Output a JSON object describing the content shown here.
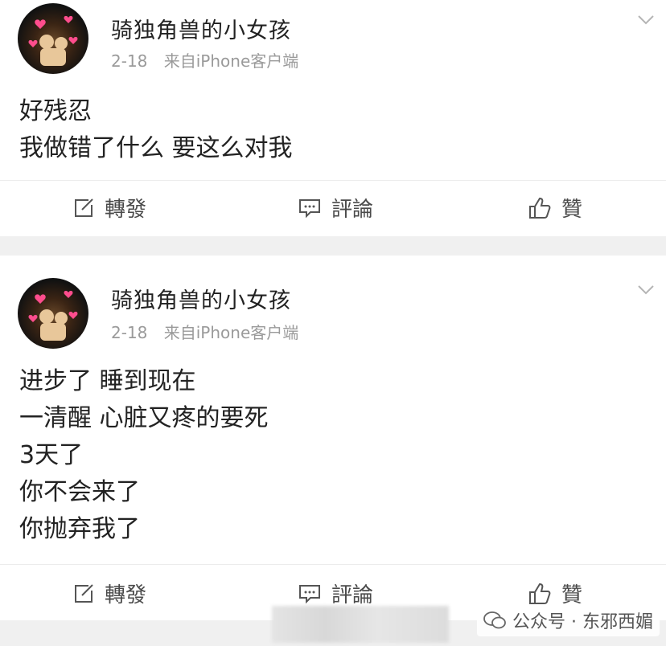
{
  "posts": [
    {
      "username": "骑独角兽的小女孩",
      "date": "2-18",
      "source": "来自iPhone客户端",
      "lines": [
        "好残忍",
        "我做错了什么 要这么对我"
      ],
      "actions": {
        "repost": "轉發",
        "comment": "評論",
        "like": "贊"
      }
    },
    {
      "username": "骑独角兽的小女孩",
      "date": "2-18",
      "source": "来自iPhone客户端",
      "lines": [
        "进步了 睡到现在",
        "一清醒 心脏又疼的要死",
        "3天了",
        "你不会来了",
        "你抛弃我了"
      ],
      "actions": {
        "repost": "轉發",
        "comment": "評論",
        "like": "贊"
      }
    }
  ],
  "watermark": "公众号 · 东邪西媚",
  "icons": {
    "avatar": "avatar-image",
    "expand": "chevron-down-icon",
    "repost": "repost-icon",
    "comment": "comment-icon",
    "like": "thumbs-up-icon",
    "watermark": "wechat-icon"
  },
  "colors": {
    "background": "#f0f0f0",
    "card": "#ffffff",
    "meta": "#9a9a9a",
    "text": "#222222"
  }
}
